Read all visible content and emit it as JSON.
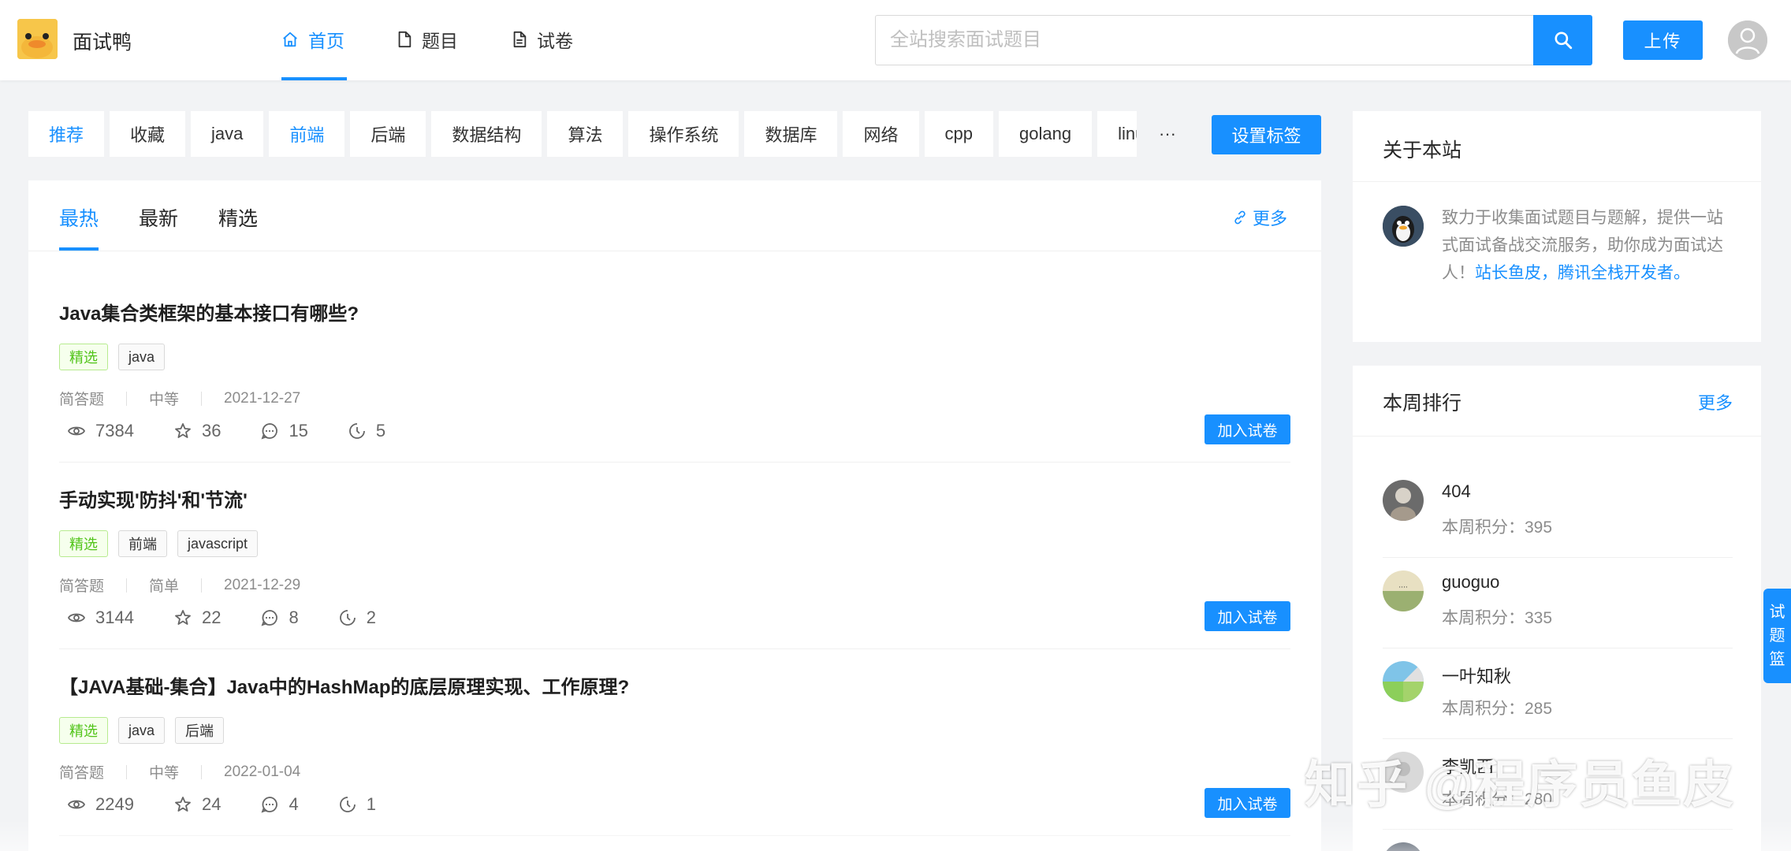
{
  "header": {
    "site_name": "面试鸭",
    "nav": [
      {
        "label": "首页",
        "icon": "home-icon",
        "active": true
      },
      {
        "label": "题目",
        "icon": "file-icon"
      },
      {
        "label": "试卷",
        "icon": "file-text-icon"
      }
    ],
    "search": {
      "placeholder": "全站搜索面试题目",
      "value": ""
    },
    "upload_label": "上传"
  },
  "tags": [
    "推荐",
    "收藏",
    "java",
    "前端",
    "后端",
    "数据结构",
    "算法",
    "操作系统",
    "数据库",
    "网络",
    "cpp",
    "golang",
    "linux"
  ],
  "tag_more_label": "···",
  "set_tags_label": "设置标签",
  "sub_tabs": [
    "最热",
    "最新",
    "精选"
  ],
  "more_label": "更多",
  "questions": [
    {
      "title": "Java集合类框架的基本接口有哪些?",
      "tags": [
        "精选",
        "java"
      ],
      "type": "简答题",
      "difficulty": "中等",
      "date": "2021-12-27",
      "views": "7384",
      "stars": "36",
      "comments": "15",
      "answers": "5",
      "add_label": "加入试卷"
    },
    {
      "title": "手动实现'防抖'和'节流'",
      "tags": [
        "精选",
        "前端",
        "javascript"
      ],
      "type": "简答题",
      "difficulty": "简单",
      "date": "2021-12-29",
      "views": "3144",
      "stars": "22",
      "comments": "8",
      "answers": "2",
      "add_label": "加入试卷"
    },
    {
      "title": "【JAVA基础-集合】Java中的HashMap的底层原理实现、工作原理?",
      "tags": [
        "精选",
        "java",
        "后端"
      ],
      "type": "简答题",
      "difficulty": "中等",
      "date": "2022-01-04",
      "views": "2249",
      "stars": "24",
      "comments": "4",
      "answers": "1",
      "add_label": "加入试卷"
    }
  ],
  "about": {
    "title": "关于本站",
    "text": "致力于收集面试题目与题解，提供一站式面试备战交流服务，助你成为面试达人！",
    "link": "站长鱼皮，腾讯全栈开发者。"
  },
  "ranking": {
    "title": "本周排行",
    "more_label": "更多",
    "score_label": "本周积分：",
    "items": [
      {
        "name": "404",
        "score": "395"
      },
      {
        "name": "guoguo",
        "score": "335"
      },
      {
        "name": "一叶知秋",
        "score": "285"
      },
      {
        "name": "李凯西",
        "score": "280"
      }
    ]
  },
  "basket_label": [
    "试",
    "题",
    "篮"
  ],
  "watermark": "知乎 @程序员鱼皮",
  "colors": {
    "primary": "#1890ff",
    "green": "#52c41a",
    "background": "#f2f3f5"
  }
}
